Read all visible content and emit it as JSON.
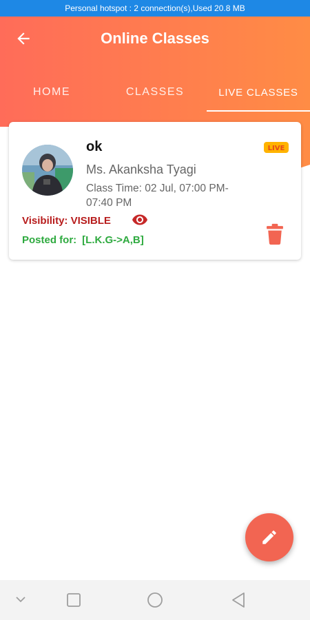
{
  "status_bar": {
    "text": "Personal hotspot : 2 connection(s),Used  20.8 MB"
  },
  "app_bar": {
    "title": "Online Classes"
  },
  "tabs": [
    {
      "label": "HOME",
      "active": false
    },
    {
      "label": "CLASSES",
      "active": false
    },
    {
      "label": "LIVE CLASSES",
      "active": true
    }
  ],
  "card": {
    "title": "ok",
    "teacher": "Ms. Akanksha Tyagi",
    "class_time": "Class Time: 02 Jul, 07:00 PM-07:40 PM",
    "logo_text": "LIVE",
    "visibility_label": "Visibility: VISIBLE",
    "posted_label": "Posted for:",
    "posted_value": "[L.K.G->A,B]"
  },
  "colors": {
    "header_gradient_start": "#ff6f5a",
    "header_gradient_end": "#ff8a45",
    "status_bar": "#1e88e5",
    "visibility_text": "#b71c1c",
    "posted_text": "#2eaa3f",
    "delete_icon": "#f26552",
    "fab": "#f26552"
  },
  "icons": {
    "back": "arrow-left-icon",
    "visibility": "eye-icon",
    "delete": "trash-icon",
    "fab": "pencil-icon"
  }
}
